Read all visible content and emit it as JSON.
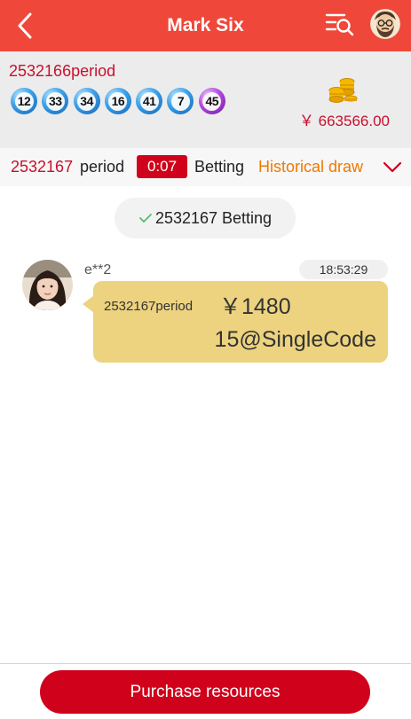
{
  "header": {
    "title": "Mark Six",
    "back_icon": "chevron-left-icon",
    "menu_icon": "menu-search-icon",
    "avatar_icon": "bearded-man-avatar"
  },
  "last_draw": {
    "period": "2532166period",
    "balls": [
      {
        "number": "12",
        "color": "blue"
      },
      {
        "number": "33",
        "color": "blue"
      },
      {
        "number": "34",
        "color": "blue"
      },
      {
        "number": "16",
        "color": "blue"
      },
      {
        "number": "41",
        "color": "blue"
      },
      {
        "number": "7",
        "color": "blue"
      },
      {
        "number": "45",
        "color": "purple"
      }
    ],
    "balance": "￥ 663566.00",
    "coins_icon": "gold-coins-icon"
  },
  "current": {
    "period_number": "2532167",
    "period_suffix": "period",
    "countdown": "0:07",
    "status": "Betting",
    "history_label": "Historical draw"
  },
  "notice": {
    "text": "2532167 Betting"
  },
  "message": {
    "user": "e**2",
    "time": "18:53:29",
    "period": "2532167period",
    "amount": "￥1480",
    "bet": "15@SingleCode"
  },
  "footer": {
    "button_label": "Purchase resources"
  },
  "colors": {
    "header_bg": "#ef473a",
    "accent_red": "#c8102e",
    "countdown_bg": "#d0021b",
    "history_orange": "#f07800",
    "bubble": "#edd37f",
    "button_bg": "#d0021b"
  }
}
